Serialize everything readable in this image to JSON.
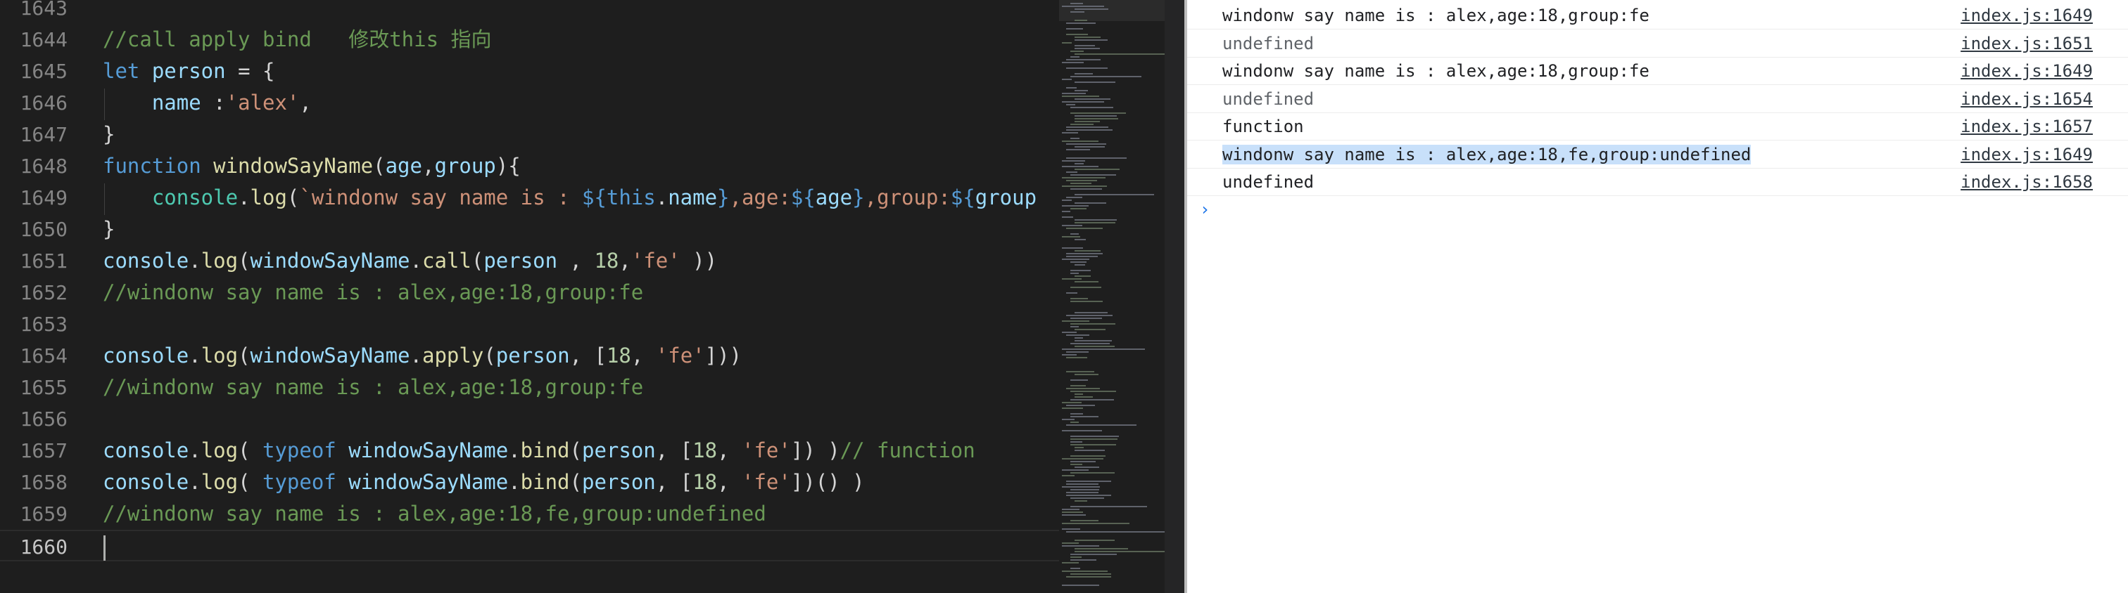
{
  "editor": {
    "lines": [
      {
        "n": "1643",
        "tokens": []
      },
      {
        "n": "1644",
        "tokens": [
          {
            "t": "//call apply bind   修改this 指向",
            "c": "comment"
          }
        ]
      },
      {
        "n": "1645",
        "tokens": [
          {
            "t": "let ",
            "c": "keyword"
          },
          {
            "t": "person",
            "c": "var"
          },
          {
            "t": " = {",
            "c": "plain"
          }
        ]
      },
      {
        "n": "1646",
        "tokens": [
          {
            "t": "    name ",
            "c": "var"
          },
          {
            "t": ":",
            "c": "plain"
          },
          {
            "t": "'alex'",
            "c": "string"
          },
          {
            "t": ",",
            "c": "plain"
          }
        ]
      },
      {
        "n": "1647",
        "tokens": [
          {
            "t": "}",
            "c": "plain"
          }
        ]
      },
      {
        "n": "1648",
        "tokens": [
          {
            "t": "function ",
            "c": "keyword"
          },
          {
            "t": "windowSayName",
            "c": "func"
          },
          {
            "t": "(",
            "c": "plain"
          },
          {
            "t": "age",
            "c": "var"
          },
          {
            "t": ",",
            "c": "plain"
          },
          {
            "t": "group",
            "c": "var"
          },
          {
            "t": "){",
            "c": "plain"
          }
        ]
      },
      {
        "n": "1649",
        "tokens": [
          {
            "t": "    console",
            "c": "obj"
          },
          {
            "t": ".",
            "c": "plain"
          },
          {
            "t": "log",
            "c": "func"
          },
          {
            "t": "(",
            "c": "plain"
          },
          {
            "t": "`windonw say name is : ",
            "c": "string"
          },
          {
            "t": "${",
            "c": "keyword"
          },
          {
            "t": "this",
            "c": "keyword"
          },
          {
            "t": ".",
            "c": "plain"
          },
          {
            "t": "name",
            "c": "var"
          },
          {
            "t": "}",
            "c": "keyword"
          },
          {
            "t": ",age:",
            "c": "string"
          },
          {
            "t": "${",
            "c": "keyword"
          },
          {
            "t": "age",
            "c": "var"
          },
          {
            "t": "}",
            "c": "keyword"
          },
          {
            "t": ",group:",
            "c": "string"
          },
          {
            "t": "${",
            "c": "keyword"
          },
          {
            "t": "group",
            "c": "var"
          }
        ]
      },
      {
        "n": "1650",
        "tokens": [
          {
            "t": "}",
            "c": "plain"
          }
        ]
      },
      {
        "n": "1651",
        "tokens": [
          {
            "t": "console",
            "c": "var"
          },
          {
            "t": ".",
            "c": "plain"
          },
          {
            "t": "log",
            "c": "func"
          },
          {
            "t": "(",
            "c": "plain"
          },
          {
            "t": "windowSayName",
            "c": "var"
          },
          {
            "t": ".",
            "c": "plain"
          },
          {
            "t": "call",
            "c": "func"
          },
          {
            "t": "(",
            "c": "plain"
          },
          {
            "t": "person",
            "c": "var"
          },
          {
            "t": " , ",
            "c": "plain"
          },
          {
            "t": "18",
            "c": "number"
          },
          {
            "t": ",",
            "c": "plain"
          },
          {
            "t": "'fe'",
            "c": "string"
          },
          {
            "t": " ))",
            "c": "plain"
          }
        ]
      },
      {
        "n": "1652",
        "tokens": [
          {
            "t": "//windonw say name is : alex,age:18,group:fe",
            "c": "comment"
          }
        ]
      },
      {
        "n": "1653",
        "tokens": []
      },
      {
        "n": "1654",
        "tokens": [
          {
            "t": "console",
            "c": "var"
          },
          {
            "t": ".",
            "c": "plain"
          },
          {
            "t": "log",
            "c": "func"
          },
          {
            "t": "(",
            "c": "plain"
          },
          {
            "t": "windowSayName",
            "c": "var"
          },
          {
            "t": ".",
            "c": "plain"
          },
          {
            "t": "apply",
            "c": "func"
          },
          {
            "t": "(",
            "c": "plain"
          },
          {
            "t": "person",
            "c": "var"
          },
          {
            "t": ", [",
            "c": "plain"
          },
          {
            "t": "18",
            "c": "number"
          },
          {
            "t": ", ",
            "c": "plain"
          },
          {
            "t": "'fe'",
            "c": "string"
          },
          {
            "t": "]))",
            "c": "plain"
          }
        ]
      },
      {
        "n": "1655",
        "tokens": [
          {
            "t": "//windonw say name is : alex,age:18,group:fe",
            "c": "comment"
          }
        ]
      },
      {
        "n": "1656",
        "tokens": []
      },
      {
        "n": "1657",
        "tokens": [
          {
            "t": "console",
            "c": "var"
          },
          {
            "t": ".",
            "c": "plain"
          },
          {
            "t": "log",
            "c": "func"
          },
          {
            "t": "( ",
            "c": "plain"
          },
          {
            "t": "typeof ",
            "c": "keyword"
          },
          {
            "t": "windowSayName",
            "c": "var"
          },
          {
            "t": ".",
            "c": "plain"
          },
          {
            "t": "bind",
            "c": "func"
          },
          {
            "t": "(",
            "c": "plain"
          },
          {
            "t": "person",
            "c": "var"
          },
          {
            "t": ", [",
            "c": "plain"
          },
          {
            "t": "18",
            "c": "number"
          },
          {
            "t": ", ",
            "c": "plain"
          },
          {
            "t": "'fe'",
            "c": "string"
          },
          {
            "t": "]) )",
            "c": "plain"
          },
          {
            "t": "// function",
            "c": "comment"
          }
        ]
      },
      {
        "n": "1658",
        "tokens": [
          {
            "t": "console",
            "c": "var"
          },
          {
            "t": ".",
            "c": "plain"
          },
          {
            "t": "log",
            "c": "func"
          },
          {
            "t": "( ",
            "c": "plain"
          },
          {
            "t": "typeof ",
            "c": "keyword"
          },
          {
            "t": "windowSayName",
            "c": "var"
          },
          {
            "t": ".",
            "c": "plain"
          },
          {
            "t": "bind",
            "c": "func"
          },
          {
            "t": "(",
            "c": "plain"
          },
          {
            "t": "person",
            "c": "var"
          },
          {
            "t": ", [",
            "c": "plain"
          },
          {
            "t": "18",
            "c": "number"
          },
          {
            "t": ", ",
            "c": "plain"
          },
          {
            "t": "'fe'",
            "c": "string"
          },
          {
            "t": "])() )",
            "c": "plain"
          }
        ]
      },
      {
        "n": "1659",
        "tokens": [
          {
            "t": "//windonw say name is : alex,age:18,fe,group:undefined",
            "c": "comment"
          }
        ]
      },
      {
        "n": "1660",
        "tokens": [],
        "active": true
      }
    ]
  },
  "console": {
    "rows": [
      {
        "msg": "windonw say name is : alex,age:18,group:fe",
        "src": "index.js:1649",
        "muted": false,
        "highlight": false
      },
      {
        "msg": "undefined",
        "src": "index.js:1651",
        "muted": true,
        "highlight": false
      },
      {
        "msg": "windonw say name is : alex,age:18,group:fe",
        "src": "index.js:1649",
        "muted": false,
        "highlight": false
      },
      {
        "msg": "undefined",
        "src": "index.js:1654",
        "muted": true,
        "highlight": false
      },
      {
        "msg": "function",
        "src": "index.js:1657",
        "muted": false,
        "highlight": false
      },
      {
        "msg": "windonw say name is : alex,age:18,fe,group:undefined",
        "src": "index.js:1649",
        "muted": false,
        "highlight": true
      },
      {
        "msg": "undefined",
        "src": "index.js:1658",
        "muted": false,
        "highlight": false
      }
    ],
    "prompt_icon": "chevron-right-icon",
    "prompt_glyph": "›"
  },
  "colors": {
    "editor_bg": "#1e1e1e",
    "console_bg": "#ffffff",
    "selection": "#c8e0fa",
    "comment": "#6a9955",
    "keyword": "#569cd6"
  }
}
